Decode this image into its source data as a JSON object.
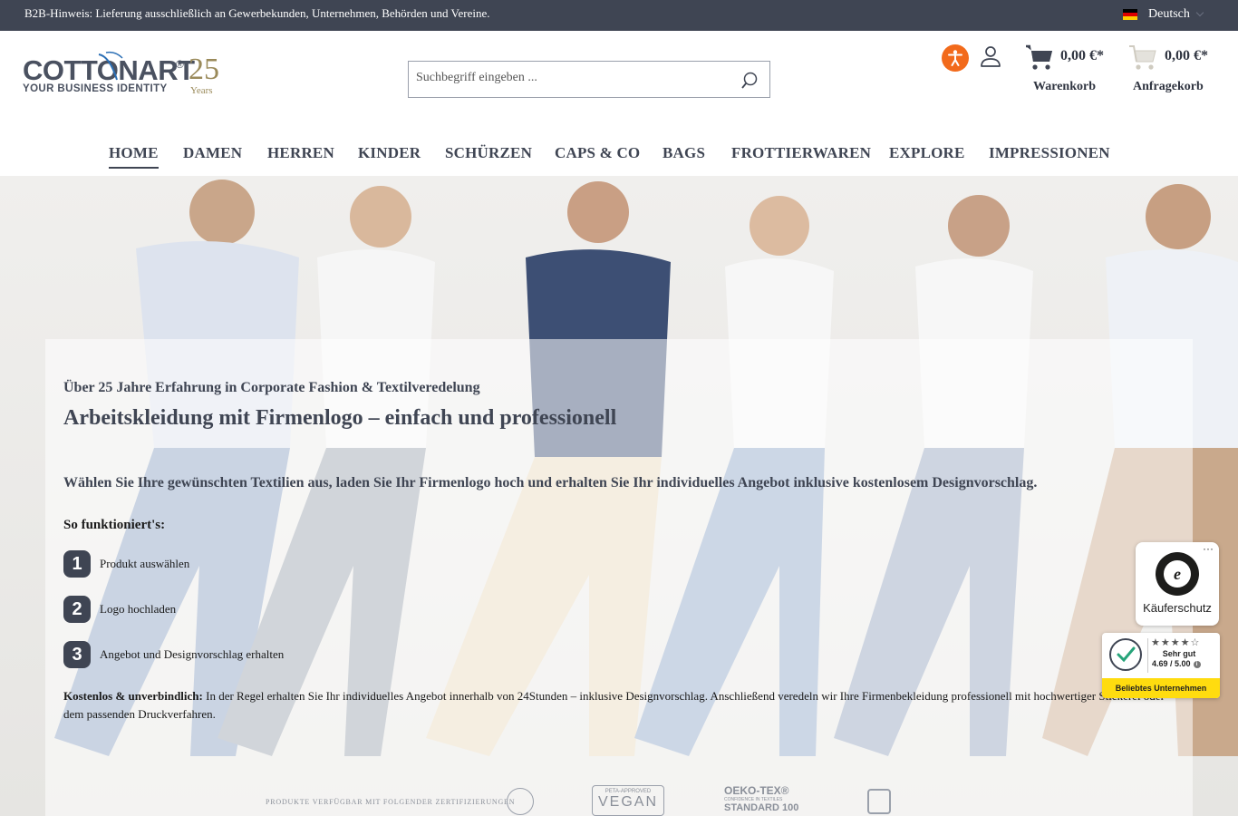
{
  "topbar": {
    "notice": "B2B-Hinweis: Lieferung ausschließlich an Gewerbekunden, Unternehmen, Behörden und Vereine.",
    "language": "Deutsch"
  },
  "logo": {
    "brand": "COTTONART",
    "registered": "®",
    "tagline": "YOUR BUSINESS IDENTITY",
    "anniversary": "25",
    "anniversary_label": "Years"
  },
  "search": {
    "placeholder": "Suchbegriff eingeben ..."
  },
  "header": {
    "cart_amount": "0,00 €*",
    "cart_label": "Warenkorb",
    "request_cart_amount": "0,00 €*",
    "request_cart_label": "Anfragekorb"
  },
  "nav": {
    "items": [
      "HOME",
      "DAMEN",
      "HERREN",
      "KINDER",
      "SCHÜRZEN",
      "CAPS & CO",
      "BAGS",
      "FROTTIERWAREN",
      "EXPLORE",
      "IMPRESSIONEN"
    ],
    "active": "HOME"
  },
  "hero": {
    "kicker": "Über 25 Jahre Erfahrung in Corporate Fashion & Textilveredelung",
    "headline": "Arbeitskleidung mit Firmenlogo – einfach und professionell",
    "intro": "Wählen Sie Ihre gewünschten Textilien aus, laden Sie Ihr Firmenlogo hoch und erhalten Sie Ihr individuelles Angebot inklusive kostenlosem Designvorschlag.",
    "howto_title": "So funktioniert's:",
    "steps": [
      {
        "num": "1",
        "text": "Produkt auswählen"
      },
      {
        "num": "2",
        "text": "Logo hochladen"
      },
      {
        "num": "3",
        "text": "Angebot und Designvorschlag erhalten"
      }
    ],
    "disclaimer_bold": "Kostenlos & unverbindlich:",
    "disclaimer_text": " In der Regel erhalten Sie Ihr individuelles Angebot innerhalb von 24Stunden – inklusive Designvorschlag. Anschließend veredeln wir Ihre Firmenbekleidung professionell mit hochwertiger Stickerei oder dem passenden Druckverfahren.",
    "certifications_caption": "PRODUKTE VERFÜGBAR MIT FOLGENDER ZERTIFIZIERUNGEN",
    "cert_vegan_top": "PETA-APPROVED",
    "cert_vegan": "VEGAN",
    "cert_oeko_1": "OEKO-TEX®",
    "cert_oeko_sub": "CONFIDENCE IN TEXTILES",
    "cert_oeko_2": "STANDARD 100"
  },
  "trusted_shops": {
    "card_label": "Käuferschutz",
    "menu": "···",
    "stars": "★★★★☆",
    "grade": "Sehr gut",
    "score": "4.69 / 5.00",
    "badge": "Beliebtes Unternehmen"
  },
  "colors": {
    "topbar": "#3f4553",
    "accessibility": "#f26a1b",
    "trusted_yellow": "#ffdc0f"
  }
}
